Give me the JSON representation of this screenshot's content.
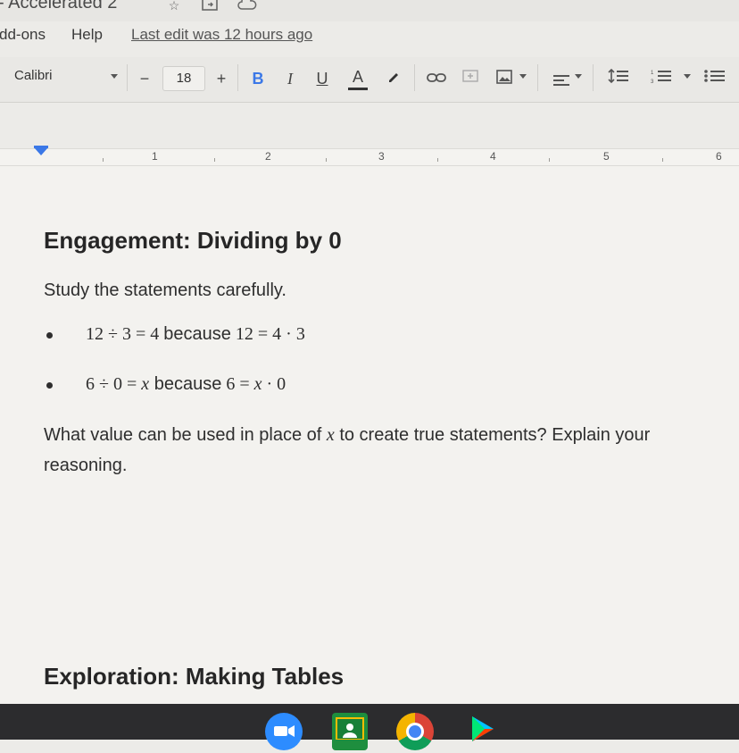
{
  "window": {
    "title": "- Accelerated 2",
    "star_icon": "star-icon",
    "move_icon": "move-to-folder-icon",
    "cloud_icon": "cloud-status-icon"
  },
  "menu": {
    "items": [
      "dd-ons",
      "Help"
    ],
    "last_edit": "Last edit was 12 hours ago"
  },
  "toolbar": {
    "font": "Calibri",
    "minus": "−",
    "font_size": "18",
    "plus": "+",
    "bold": "B",
    "italic": "I",
    "underline": "U",
    "text_color": "A",
    "accent_color": "#3b78e7"
  },
  "ruler": {
    "numbers": [
      "1",
      "2",
      "3",
      "4",
      "5",
      "6"
    ]
  },
  "document": {
    "heading1": "Engagement: Dividing by 0",
    "intro": "Study the statements carefully.",
    "bullet1_a": "12 ÷ 3 = 4 ",
    "bullet1_word": "because",
    "bullet1_b": " 12 = 4 · 3",
    "bullet2_a": "6 ÷ 0 = ",
    "bullet2_x1": "x",
    "bullet2_word": " because",
    "bullet2_b": " 6 = ",
    "bullet2_x2": "x",
    "bullet2_c": " · 0",
    "question_a": "What value can be used in place of ",
    "question_x": "x",
    "question_b": " to create true statements? Explain your",
    "question_line2": "reasoning.",
    "heading2": "Exploration: Making Tables"
  },
  "shelf": {
    "apps": [
      "zoom-icon",
      "classroom-icon",
      "chrome-icon",
      "play-store-icon"
    ]
  }
}
